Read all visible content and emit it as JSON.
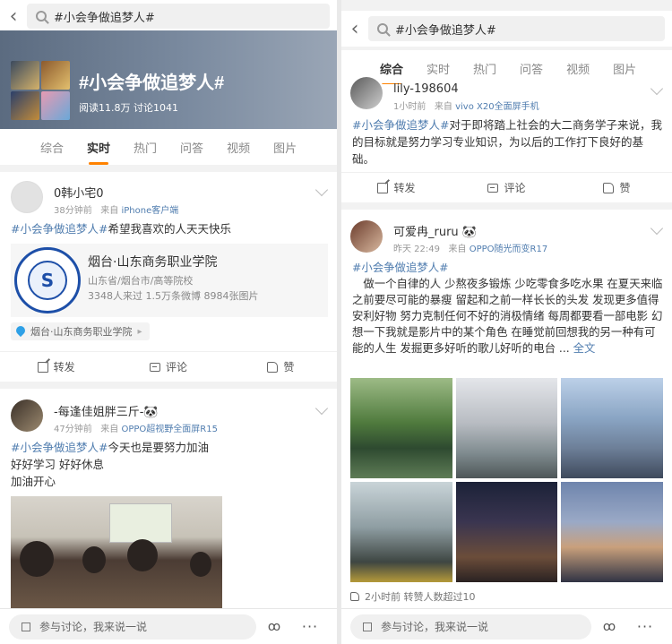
{
  "left": {
    "search_text": "#小会争做追梦人#",
    "topic": {
      "title": "#小会争做追梦人#",
      "stats": "阅读11.8万 讨论1041"
    },
    "tabs": [
      "综合",
      "实时",
      "热门",
      "问答",
      "视频",
      "图片"
    ],
    "active_tab": "实时",
    "post1": {
      "name": "0韩小宅0",
      "time": "38分钟前",
      "source_prefix": "来自",
      "source": "iPhone客户端",
      "tag": "#小会争做追梦人#",
      "text": "希望我喜欢的人天天快乐",
      "link": {
        "logo_text": "S",
        "title": "烟台·山东商务职业学院",
        "subtitle": "山东省/烟台市/高等院校",
        "stats": "3348人来过 1.5万条微博 8984张图片"
      },
      "location": "烟台·山东商务职业学院",
      "actions": {
        "repost": "转发",
        "comment": "评论",
        "like": "赞"
      }
    },
    "post2": {
      "name": "-每逢佳姐胖三斤-🐼",
      "time": "47分钟前",
      "source_prefix": "来自",
      "source": "OPPO超视野全面屏R15",
      "tag": "#小会争做追梦人#",
      "line1": "今天也是要努力加油",
      "line2": "好好学习 好好休息",
      "line3": "加油开心"
    },
    "bottom": {
      "placeholder": "参与讨论，我来说一说",
      "share": "ꝏ",
      "more": "···"
    }
  },
  "right": {
    "search_text": "#小会争做追梦人#",
    "tabs": [
      "综合",
      "实时",
      "热门",
      "问答",
      "视频",
      "图片"
    ],
    "active_tab": "综合",
    "post1": {
      "name": "lily-198604",
      "time": "1小时前",
      "source_prefix": "来自",
      "source": "vivo X20全面屏手机",
      "tag": "#小会争做追梦人#",
      "text": "对于即将踏上社会的大二商务学子来说，我的目标就是努力学习专业知识，为以后的工作打下良好的基础。",
      "actions": {
        "repost": "转发",
        "comment": "评论",
        "like": "赞"
      }
    },
    "post2": {
      "name": "可爱冉_ruru 🐼",
      "time": "昨天 22:49",
      "source_prefix": "来自",
      "source": "OPPO随光而变R17",
      "tag": "#小会争做追梦人#",
      "text": "做一个自律的人 少熬夜多锻炼 少吃零食多吃水果 在夏天来临之前要尽可能的暴瘦 留起和之前一样长长的头发 发现更多值得安利好物 努力克制任何不好的消极情绪 每周都要看一部电影 幻想一下我就是影片中的某个角色 在睡觉前回想我的另一种有可能的人生 发掘更多好听的歌儿好听的电台 ... ",
      "full_text_link": "全文",
      "footer": "2小时前 转赞人数超过10"
    },
    "bottom": {
      "placeholder": "参与讨论，我来说一说",
      "share": "ꝏ",
      "more": "···"
    }
  },
  "colors": {
    "accent": "#ff8200",
    "link": "#507daf"
  }
}
